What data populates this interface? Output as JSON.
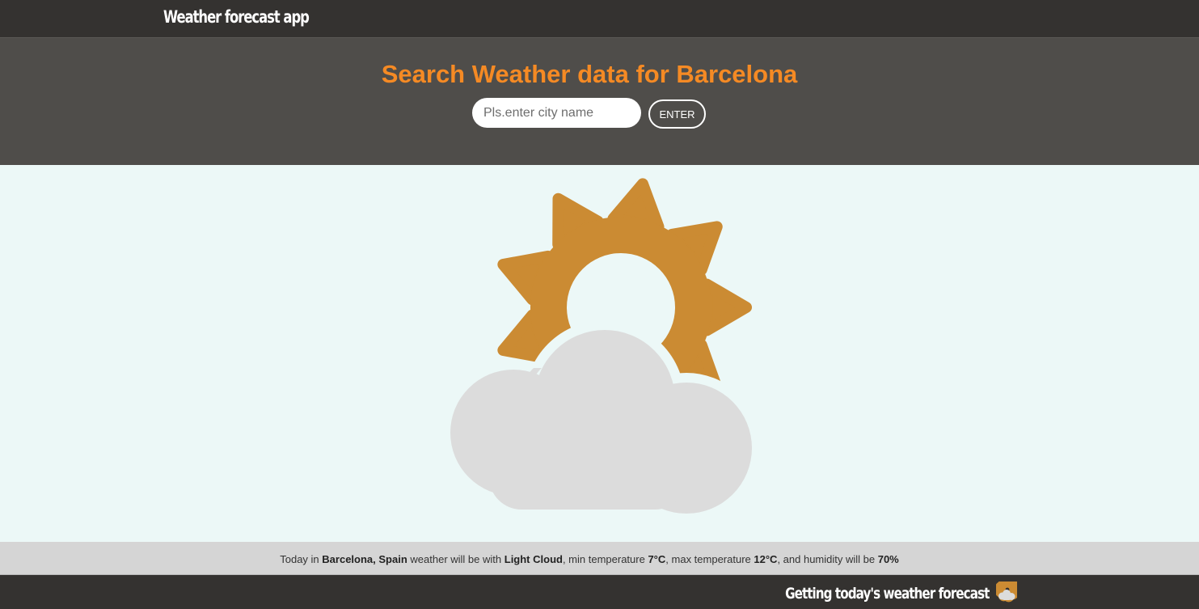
{
  "app": {
    "title": "Weather forecast app"
  },
  "search": {
    "heading": "Search Weather data for Barcelona",
    "input_value": "",
    "input_placeholder": "Pls.enter city name",
    "button_label": "ENTER"
  },
  "weather": {
    "icon": "partly-cloudy-icon",
    "sun_color": "#cb8b33",
    "cloud_color": "#dcdcdc"
  },
  "summary": {
    "prefix": "Today in ",
    "city": "Barcelona,",
    "country": "Spain",
    "weather_intro": " weather will be with ",
    "condition": "Light Cloud",
    "min_intro": ", min temperature ",
    "min_temp": "7°C",
    "max_intro": ", max temperature ",
    "max_temp": "12°C",
    "humidity_intro": ", and humidity will be ",
    "humidity": "70%"
  },
  "footer": {
    "text": "Getting today's weather forecast",
    "icon": "partly-cloudy-icon"
  },
  "colors": {
    "header_bg": "#343230",
    "search_bg": "#4f4d4a",
    "accent": "#f58a24",
    "display_bg": "#ecf8f7",
    "summary_bg": "#d5d5d5"
  }
}
